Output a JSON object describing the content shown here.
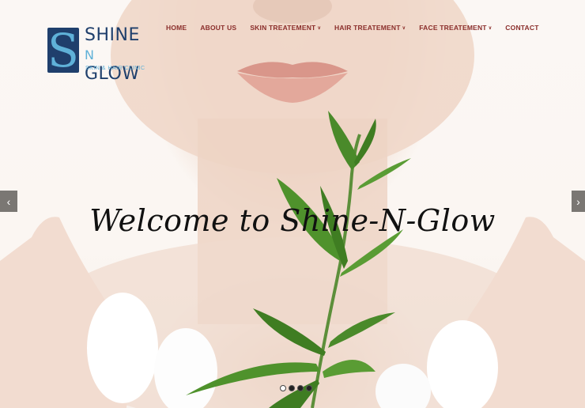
{
  "logo": {
    "line1": "SHINE",
    "line2_n": "N",
    "line2": "GLOW",
    "tagline": "SKIN & HAIR CLINIC",
    "mark_letter": "S"
  },
  "nav": {
    "items": [
      {
        "label": "HOME",
        "dropdown": false
      },
      {
        "label": "ABOUT US",
        "dropdown": false
      },
      {
        "label": "SKIN TREATEMENT",
        "dropdown": true
      },
      {
        "label": "HAIR TREATEMENT",
        "dropdown": true
      },
      {
        "label": "FACE TREATEMENT",
        "dropdown": true
      },
      {
        "label": "CONTACT",
        "dropdown": false
      }
    ],
    "color": "#8a2d2a"
  },
  "hero": {
    "headline": "Welcome to Shine-N-Glow",
    "prev_icon": "chevron-left-icon",
    "next_icon": "chevron-right-icon",
    "slide_count": 4,
    "active_slide": 1
  },
  "colors": {
    "brand_navy": "#1f3f6c",
    "brand_light_blue": "#5fb1d8",
    "leaf_green": "#4a8a2a"
  }
}
